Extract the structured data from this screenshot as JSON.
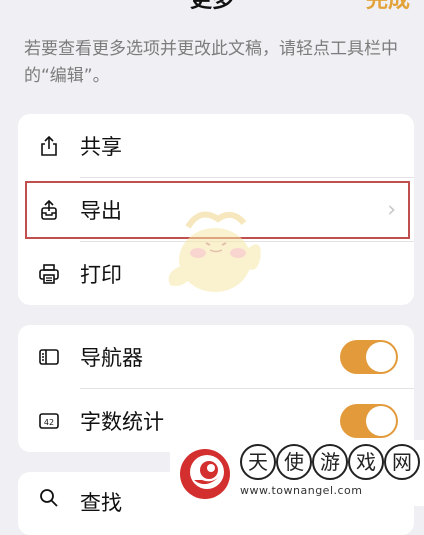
{
  "header": {
    "title": "更多",
    "done_label": "完成"
  },
  "hint_text": "若要查看更多选项并更改此文稿，请轻点工具栏中的“编辑”。",
  "group1": {
    "items": [
      {
        "label": "共享",
        "icon": "share-icon"
      },
      {
        "label": "导出",
        "icon": "export-icon",
        "chevron": "›"
      },
      {
        "label": "打印",
        "icon": "printer-icon"
      }
    ]
  },
  "group2": {
    "items": [
      {
        "label": "导航器",
        "icon": "navigator-icon",
        "toggle_on": true
      },
      {
        "label": "字数统计",
        "icon": "word-count-icon",
        "icon_text": "42",
        "toggle_on": true
      }
    ]
  },
  "group3": {
    "items": [
      {
        "label": "查找",
        "icon": "search-icon"
      }
    ]
  },
  "watermark": {
    "name": "天使游戏网",
    "url": "www.townangel.com"
  },
  "colors": {
    "accent": "#e39a3a",
    "highlight_border": "#c0504d",
    "background": "#efeff4"
  }
}
